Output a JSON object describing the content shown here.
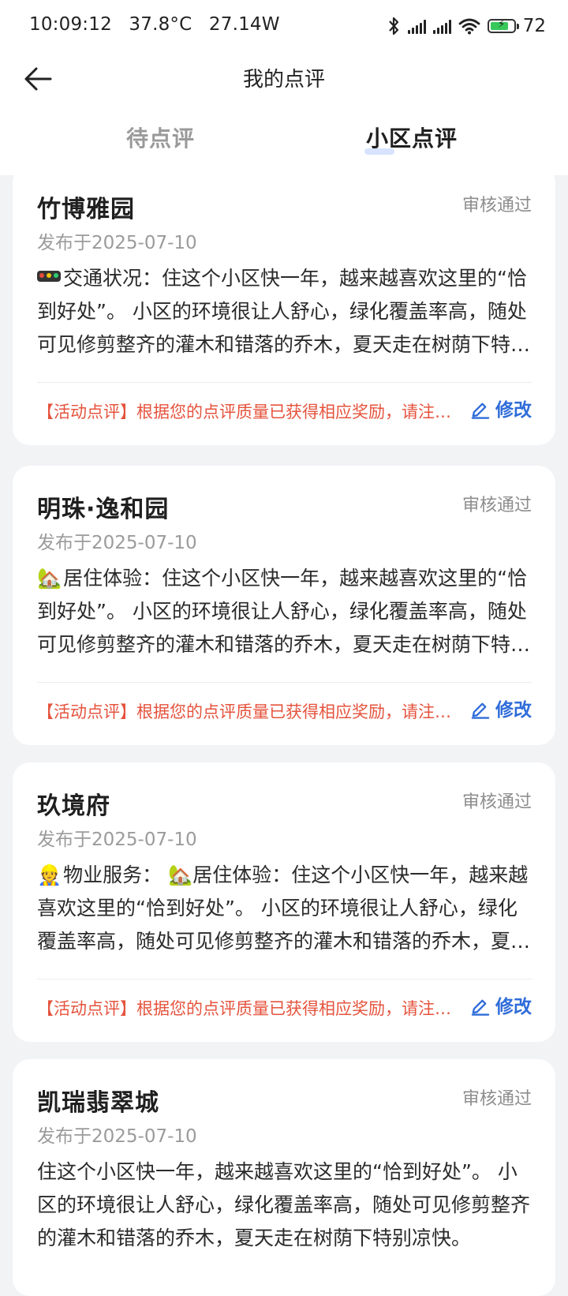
{
  "status_bar": {
    "time": "10:09:12",
    "temperature": "37.8°C",
    "power": "27.14W",
    "battery": "72"
  },
  "header": {
    "title": "我的点评"
  },
  "tabs": [
    {
      "label": "待点评",
      "active": false
    },
    {
      "label": "小区点评",
      "active": true
    }
  ],
  "reviews": [
    {
      "name": "竹博雅园",
      "status": "审核通过",
      "date": "发布于2025-07-10",
      "icon": "traffic-light-icon",
      "content": "交通状况：住这个小区快一年，越来越喜欢这里的“恰到好处”。 小区的环境很让人舒心，绿化覆盖率高，随处可见修剪整齐的灌木和错落的乔木，夏天走在树荫下特别凉快。",
      "reward": "【活动点评】根据您的点评质量已获得相应奖励，请注意查收",
      "edit_label": "修改"
    },
    {
      "name": "明珠·逸和园",
      "status": "审核通过",
      "date": "发布于2025-07-10",
      "icon": "house-icon",
      "content": "居住体验：住这个小区快一年，越来越喜欢这里的“恰到好处”。 小区的环境很让人舒心，绿化覆盖率高，随处可见修剪整齐的灌木和错落的乔木，夏天走在树荫下特别凉快。",
      "reward": "【活动点评】根据您的点评质量已获得相应奖励，请注意查收",
      "edit_label": "修改"
    },
    {
      "name": "玖境府",
      "status": "审核通过",
      "date": "发布于2025-07-10",
      "icon": "worker-icon",
      "content": "物业服务： 🏡居住体验：住这个小区快一年，越来越喜欢这里的“恰到好处”。 小区的环境很让人舒心，绿化覆盖率高，随处可见修剪整齐的灌木和错落的乔木，夏天走在树荫下特别凉快。",
      "reward": "【活动点评】根据您的点评质量已获得相应奖励，请注意查收",
      "edit_label": "修改"
    },
    {
      "name": "凯瑞翡翠城",
      "status": "审核通过",
      "date": "发布于2025-07-10",
      "icon": "",
      "content": "住这个小区快一年，越来越喜欢这里的“恰到好处”。 小区的环境很让人舒心，绿化覆盖率高，随处可见修剪整齐的灌木和错落的乔木，夏天走在树荫下特别凉快。",
      "reward": "",
      "edit_label": ""
    }
  ]
}
